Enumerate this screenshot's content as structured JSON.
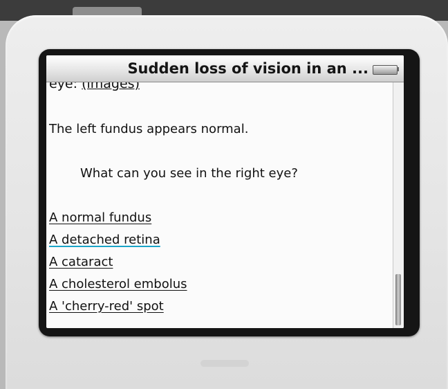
{
  "screen": {
    "title": "Sudden loss of vision in an ...",
    "cut_off_text": {
      "prefix": "eye:",
      "link": "(images)"
    },
    "text": "The left fundus appears normal.",
    "question": "What can you see in the right eye?",
    "options": [
      {
        "label": "A normal fundus"
      },
      {
        "label": "A detached retina",
        "selected": true
      },
      {
        "label": "A cataract"
      },
      {
        "label": "A cholesterol embolus"
      },
      {
        "label": "A 'cherry-red' spot"
      }
    ]
  },
  "colors": {
    "selection_underline": "#1aa4c8",
    "bezel": "#151515",
    "screen_background": "#fbfbfb"
  },
  "icons": [
    "battery-icon"
  ]
}
